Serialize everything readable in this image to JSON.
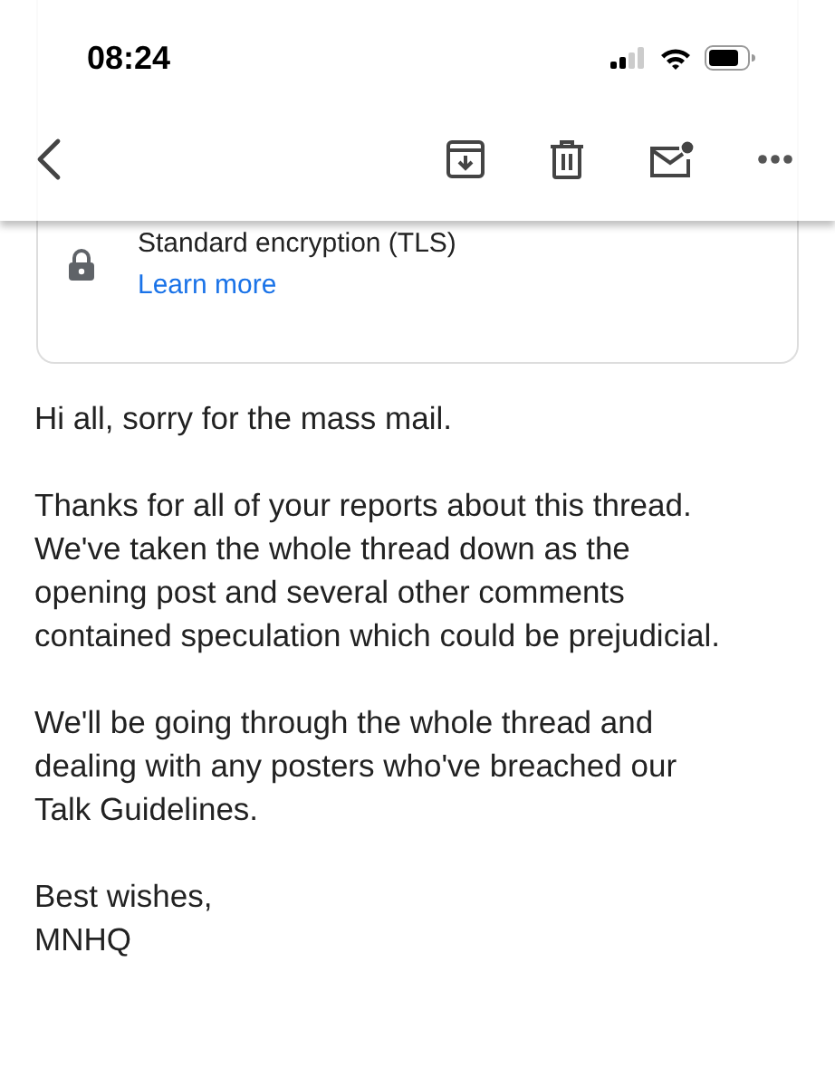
{
  "status_bar": {
    "time": "08:24"
  },
  "encryption": {
    "title": "Standard encryption (TLS)",
    "link": "Learn more"
  },
  "message": [
    "Hi all, sorry for the mass mail.",
    "Thanks for all of your reports about this thread. We've taken the whole thread down as the opening post and several other comments contained speculation which could be prejudicial.",
    "We'll be going through the whole thread and dealing with any posters who've breached our Talk Guidelines.",
    "Best wishes,\nMNHQ"
  ]
}
